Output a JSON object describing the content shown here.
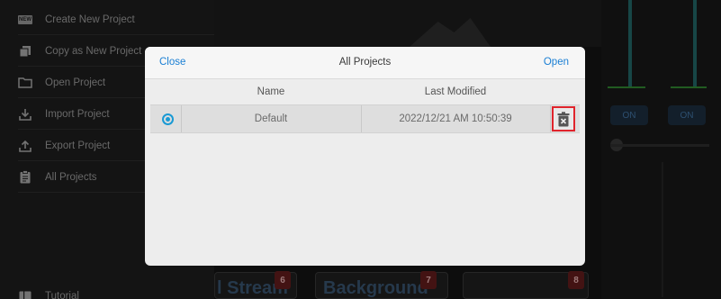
{
  "sidebar": {
    "items": [
      {
        "label": "Create New Project",
        "icon": "new-badge-icon"
      },
      {
        "label": "Copy as New Project",
        "icon": "copy-icon"
      },
      {
        "label": "Open Project",
        "icon": "folder-icon"
      },
      {
        "label": "Import Project",
        "icon": "import-icon"
      },
      {
        "label": "Export Project",
        "icon": "export-icon"
      },
      {
        "label": "All Projects",
        "icon": "clipboard-icon"
      },
      {
        "label": "Tutorial",
        "icon": "tutorial-icon"
      }
    ],
    "new_badge_text": "NEW"
  },
  "dialog": {
    "close_label": "Close",
    "title": "All Projects",
    "open_label": "Open",
    "columns": [
      "Name",
      "Last Modified"
    ],
    "rows": [
      {
        "name": "Default",
        "last_modified": "2022/12/21 AM 10:50:39",
        "selected": true
      }
    ]
  },
  "background": {
    "on_labels": [
      "ON",
      "ON"
    ],
    "tiles": [
      {
        "text": "l Stream",
        "badge": "6"
      },
      {
        "text": "Background",
        "badge": "7"
      },
      {
        "text": "",
        "badge": "8"
      }
    ]
  },
  "colors": {
    "accent": "#1a7fd4",
    "radio": "#1a9ad4",
    "highlight_border": "#e0242c"
  }
}
